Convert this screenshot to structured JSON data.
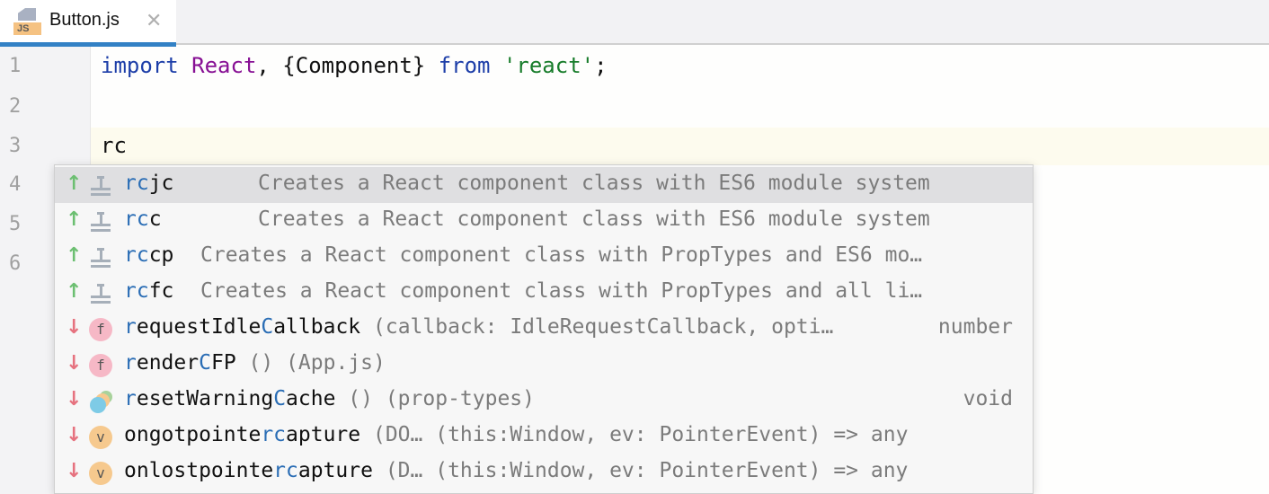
{
  "tab": {
    "label": "Button.js",
    "icon_badge": "JS",
    "close_glyph": "✕"
  },
  "editor": {
    "line_numbers": [
      "1",
      "2",
      "3",
      "4",
      "5",
      "6"
    ],
    "line1": {
      "kw1": "import",
      "cls": "React",
      "mid": ", {Component} ",
      "kw2": "from",
      "str": "'react'",
      "end": ";"
    },
    "line3": "rc"
  },
  "completion": {
    "items": [
      {
        "dir": "↑",
        "kind": "template",
        "match": "rc",
        "rest": "jc",
        "desc": "Creates a React component class with ES6 module system",
        "selected": true
      },
      {
        "dir": "↑",
        "kind": "template",
        "match": "rc",
        "rest": "c",
        "desc": "Creates a React component class with ES6 module system"
      },
      {
        "dir": "↑",
        "kind": "template",
        "match": "rc",
        "rest": "cp",
        "desc": "Creates a React component class with PropTypes and ES6 mo…"
      },
      {
        "dir": "↑",
        "kind": "template",
        "match": "rc",
        "rest": "fc",
        "desc": "Creates a React component class with PropTypes and all li…"
      },
      {
        "dir": "↓",
        "kind": "function",
        "icon_letter": "f",
        "p1": "r",
        "p2": "equestIdle",
        "p3": "C",
        "p4": "allback",
        "desc": "(callback: IdleRequestCallback, opti…",
        "type": "number"
      },
      {
        "dir": "↓",
        "kind": "function",
        "icon_letter": "f",
        "p1": "r",
        "p2": "ender",
        "p3": "C",
        "p4": "FP",
        "desc": "() (App.js)",
        "type": ""
      },
      {
        "dir": "↓",
        "kind": "module-function",
        "p1": "r",
        "p2": "esetWarning",
        "p3": "C",
        "p4": "ache",
        "desc": "() (prop-types)",
        "type": "void"
      },
      {
        "dir": "↓",
        "kind": "variable",
        "icon_letter": "v",
        "p1": "",
        "p2": "ongotpointe",
        "p3": "rc",
        "p4": "apture",
        "desc": "(DO… (this:Window, ev: PointerEvent) => any",
        "type": ""
      },
      {
        "dir": "↓",
        "kind": "variable",
        "icon_letter": "v",
        "p1": "",
        "p2": "onlostpointe",
        "p3": "rc",
        "p4": "apture",
        "desc": "(D… (this:Window, ev: PointerEvent) => any",
        "type": ""
      }
    ]
  }
}
